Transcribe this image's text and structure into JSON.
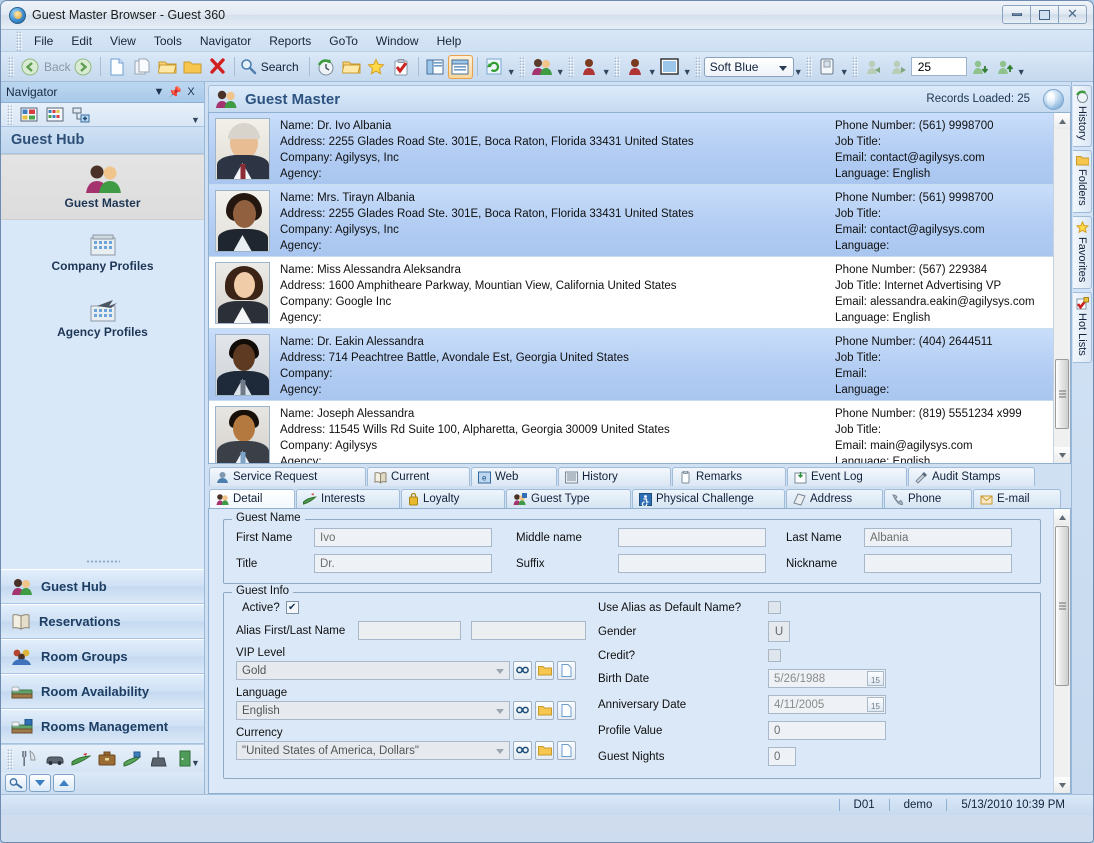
{
  "window": {
    "title": "Guest Master Browser - Guest 360",
    "icon": "app-globe-icon",
    "buttons": {
      "minimize": "minimize",
      "maximize": "maximize",
      "close": "close"
    }
  },
  "menubar": [
    "File",
    "Edit",
    "View",
    "Tools",
    "Navigator",
    "Reports",
    "GoTo",
    "Window",
    "Help"
  ],
  "toolbar": {
    "back_label": "Back",
    "search_label": "Search",
    "theme_value": "Soft Blue",
    "count_value": "25",
    "icons": [
      "back-arrow-icon",
      "forward-arrow-icon",
      "new-document-icon",
      "copy-document-icon",
      "open-folder-icon",
      "folder-icon",
      "delete-x-icon",
      "search-icon",
      "history-clock-icon",
      "folders-icon",
      "favorites-star-icon",
      "hot-lists-icon",
      "panel-left-icon",
      "panel-bottom-icon",
      "refresh-icon",
      "guests-icon",
      "company-icon",
      "agency-icon",
      "window-icon",
      "printer-icon",
      "prev-record-icon",
      "next-record-icon",
      "load-down-icon",
      "load-up-icon"
    ]
  },
  "navigator": {
    "panel_title": "Navigator",
    "hub_title": "Guest Hub",
    "toolbar_icons": [
      "grid-view-icon",
      "list-view-icon",
      "add-node-icon"
    ],
    "hub_items": [
      {
        "label": "Guest Master",
        "icon": "guests-icon",
        "selected": true
      },
      {
        "label": "Company Profiles",
        "icon": "company-building-icon",
        "selected": false
      },
      {
        "label": "Agency Profiles",
        "icon": "agency-plane-icon",
        "selected": false
      }
    ],
    "bottom_bars": [
      {
        "label": "Guest Hub",
        "icon": "guests-icon"
      },
      {
        "label": "Reservations",
        "icon": "book-icon"
      },
      {
        "label": "Room Groups",
        "icon": "room-groups-icon"
      },
      {
        "label": "Room Availability",
        "icon": "bed-icon"
      },
      {
        "label": "Rooms Management",
        "icon": "bed-manage-icon"
      }
    ],
    "strip_icons": [
      "utensils-icon",
      "car-icon",
      "golf-icon",
      "briefcase-icon",
      "spa-icon",
      "housekeeping-icon",
      "door-icon"
    ],
    "status_buttons": [
      "search-key-icon",
      "scroll-down-icon",
      "scroll-up-icon"
    ]
  },
  "content": {
    "header_title": "Guest Master",
    "header_icon": "guests-icon",
    "records_loaded": "Records Loaded: 25",
    "records": [
      {
        "name": "Name: Dr. Ivo Albania",
        "address": "Address: 2255 Glades Road Ste. 301E, Boca Raton, Florida 33431 United States",
        "company": "Company: Agilysys, Inc",
        "agency": "Agency:",
        "phone": "Phone Number: (561) 9998700",
        "job_title": "Job Title:",
        "email": "Email: contact@agilysys.com",
        "language": "Language: English",
        "selected": true,
        "photo": "male-gray-hair"
      },
      {
        "name": "Name: Mrs. Tirayn Albania",
        "address": "Address: 2255 Glades Road Ste. 301E, Boca Raton, Florida 33431 United States",
        "company": "Company: Agilysys, Inc",
        "agency": "Agency:",
        "phone": "Phone Number: (561) 9998700",
        "job_title": "Job Title:",
        "email": "Email: contact@agilysys.com",
        "language": "Language:",
        "selected": true,
        "photo": "female-dark-hair"
      },
      {
        "name": "Name: Miss Alessandra Aleksandra",
        "address": "Address: 1600 Amphitheare Parkway, Mountian View, California United States",
        "company": "Company: Google Inc",
        "agency": "Agency:",
        "phone": "Phone Number: (567) 229384",
        "job_title": "Job Title: Internet Advertising VP",
        "email": "Email: alessandra.eakin@agilysys.com",
        "language": "Language: English",
        "selected": false,
        "photo": "female-brown-hair"
      },
      {
        "name": "Name: Dr. Eakin Alessandra",
        "address": "Address: 714 Peachtree Battle, Avondale Est, Georgia United States",
        "company": "Company:",
        "agency": "Agency:",
        "phone": "Phone Number: (404) 2644511",
        "job_title": "Job Title:",
        "email": "Email:",
        "language": "Language:",
        "selected": true,
        "photo": "male-dark-skin"
      },
      {
        "name": "Name: Joseph Alessandra",
        "address": "Address: 11545 Wills Rd Suite 100, Alpharetta, Georgia 30009 United States",
        "company": "Company: Agilysys",
        "agency": "Agency:",
        "phone": "Phone Number: (819) 5551234 x999",
        "job_title": "Job Title:",
        "email": "Email: main@agilysys.com",
        "language": "Language: English",
        "selected": false,
        "photo": "male-young"
      }
    ]
  },
  "tabs_top": [
    {
      "label": "Service Request",
      "icon": "service-request-icon",
      "active": false
    },
    {
      "label": "Current",
      "icon": "current-book-icon",
      "active": false
    },
    {
      "label": "Web",
      "icon": "web-icon",
      "active": false
    },
    {
      "label": "History",
      "icon": "history-icon",
      "active": false
    },
    {
      "label": "Remarks",
      "icon": "remarks-icon",
      "active": false
    },
    {
      "label": "Event Log",
      "icon": "event-log-icon",
      "active": false
    },
    {
      "label": "Audit Stamps",
      "icon": "audit-stamps-icon",
      "active": false
    }
  ],
  "tabs_bottom": [
    {
      "label": "Detail",
      "icon": "detail-icon",
      "active": true
    },
    {
      "label": "Interests",
      "icon": "interests-icon",
      "active": false
    },
    {
      "label": "Loyalty",
      "icon": "loyalty-icon",
      "active": false
    },
    {
      "label": "Guest Type",
      "icon": "guest-type-icon",
      "active": false
    },
    {
      "label": "Physical Challenge",
      "icon": "physical-challenge-icon",
      "active": false
    },
    {
      "label": "Address",
      "icon": "address-icon",
      "active": false
    },
    {
      "label": "Phone",
      "icon": "phone-icon",
      "active": false
    },
    {
      "label": "E-mail",
      "icon": "email-icon",
      "active": false
    }
  ],
  "detail": {
    "guest_name": {
      "legend": "Guest Name",
      "first_name_label": "First Name",
      "first_name_value": "Ivo",
      "middle_name_label": "Middle name",
      "middle_name_value": "",
      "last_name_label": "Last Name",
      "last_name_value": "Albania",
      "title_label": "Title",
      "title_value": "Dr.",
      "suffix_label": "Suffix",
      "suffix_value": "",
      "nickname_label": "Nickname",
      "nickname_value": ""
    },
    "guest_info": {
      "legend": "Guest Info",
      "active_label": "Active?",
      "active_checked": "✔",
      "alias_label": "Alias First/Last Name",
      "alias_first_value": "",
      "alias_last_value": "",
      "vip_level_label": "VIP Level",
      "vip_level_value": "Gold",
      "language_label": "Language",
      "language_value": "English",
      "currency_label": "Currency",
      "currency_value": "\"United States of America, Dollars\"",
      "use_alias_label": "Use Alias as Default Name?",
      "gender_label": "Gender",
      "gender_value": "U",
      "credit_label": "Credit?",
      "birth_date_label": "Birth Date",
      "birth_date_value": "5/26/1988",
      "anniversary_label": "Anniversary Date",
      "anniversary_value": "4/11/2005",
      "profile_value_label": "Profile Value",
      "profile_value_value": "0",
      "guest_nights_label": "Guest Nights",
      "guest_nights_value": "0"
    }
  },
  "right_tabs": [
    {
      "label": "History",
      "icon": "history-icon"
    },
    {
      "label": "Folders",
      "icon": "folders-icon"
    },
    {
      "label": "Favorites",
      "icon": "favorites-star-icon"
    },
    {
      "label": "Hot Lists",
      "icon": "hot-lists-icon"
    }
  ],
  "statusbar": {
    "terminal": "D01",
    "user": "demo",
    "datetime": "5/13/2010 10:39 PM"
  },
  "colors": {
    "accent": "#2d5380",
    "selected_row": "#b3cdf3",
    "window_bg": "#cfe0f2",
    "panel_bg": "#dae8f8"
  }
}
